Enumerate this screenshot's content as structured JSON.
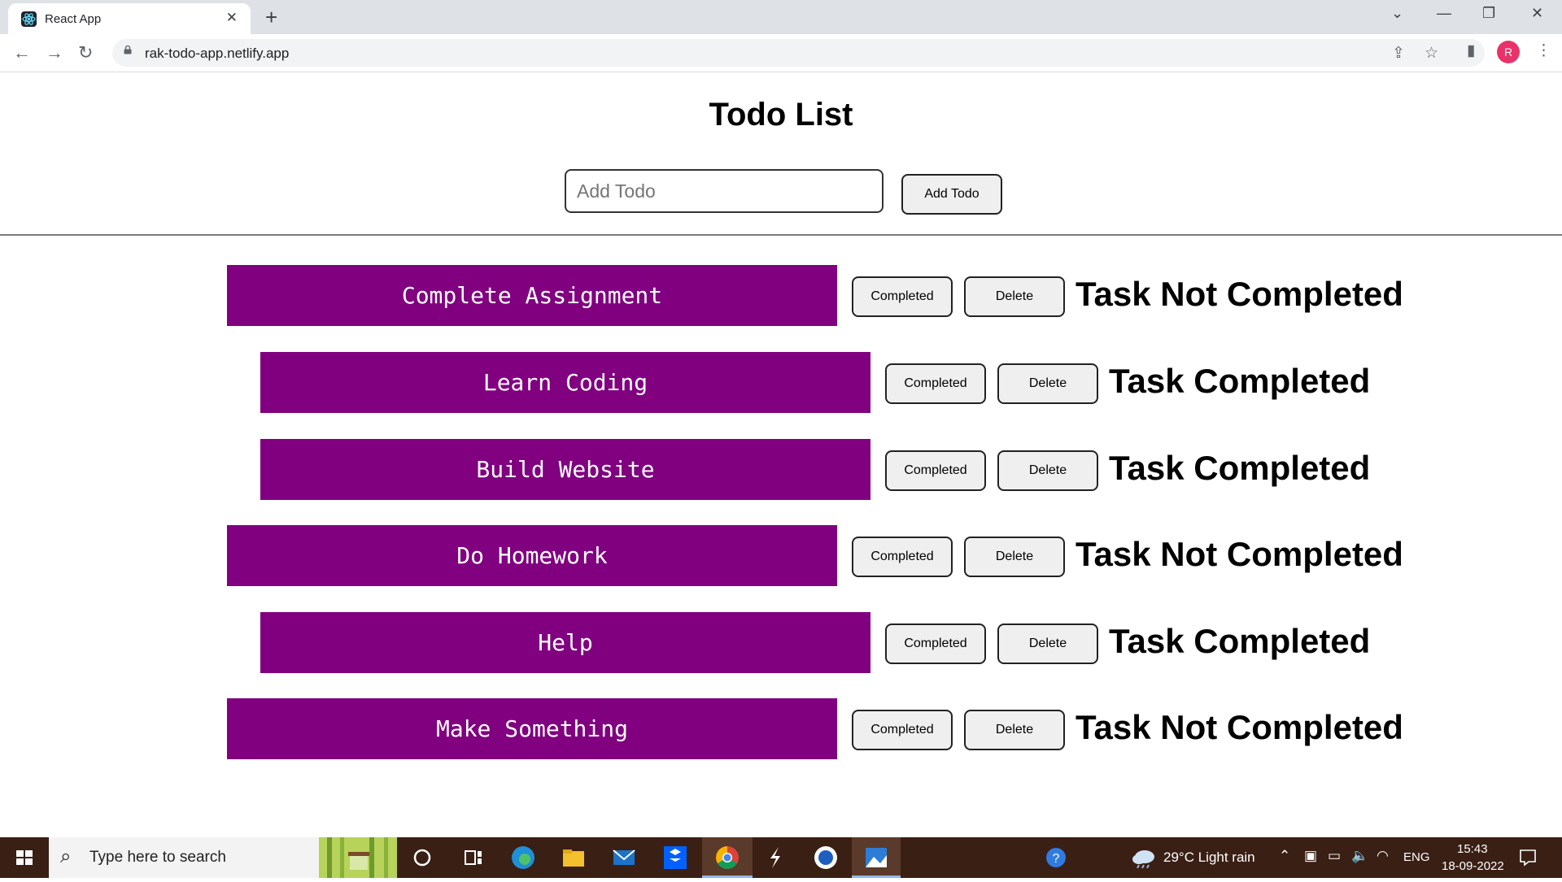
{
  "browser": {
    "tab_title": "React App",
    "tab_close": "✕",
    "new_tab": "+",
    "url": "rak-todo-app.netlify.app",
    "avatar_initial": "R",
    "window_controls": {
      "dropdown": "⌄",
      "minimize": "—",
      "restore": "❐",
      "close": "✕"
    },
    "icons": {
      "back": "←",
      "forward": "→",
      "reload": "↻",
      "share": "⇪",
      "bookmark": "☆",
      "side_panel": "▮",
      "menu": "⋮"
    }
  },
  "app": {
    "title": "Todo List",
    "input_placeholder": "Add Todo",
    "input_value": "",
    "add_button": "Add Todo",
    "completed_label": "Completed",
    "delete_label": "Delete",
    "todos": [
      {
        "text": "Complete Assignment",
        "status": "Task Not Completed",
        "completed": false
      },
      {
        "text": "Learn Coding",
        "status": "Task Completed",
        "completed": true
      },
      {
        "text": "Build Website",
        "status": "Task Completed",
        "completed": true
      },
      {
        "text": "Do Homework",
        "status": "Task Not Completed",
        "completed": false
      },
      {
        "text": "Help",
        "status": "Task Completed",
        "completed": true
      },
      {
        "text": "Make Something",
        "status": "Task Not Completed",
        "completed": false
      }
    ],
    "colors": {
      "todo_background": "#800080",
      "todo_text": "#ffffff"
    }
  },
  "taskbar": {
    "search_placeholder": "Type here to search",
    "weather": "29°C  Light rain",
    "language": "ENG",
    "time": "15:43",
    "date": "18-09-2022",
    "pinned_apps": [
      "task-view-icon",
      "edge-icon",
      "file-explorer-icon",
      "mail-icon",
      "dropbox-icon",
      "chrome-icon",
      "app-s-icon",
      "app-w-icon",
      "photos-icon"
    ]
  }
}
